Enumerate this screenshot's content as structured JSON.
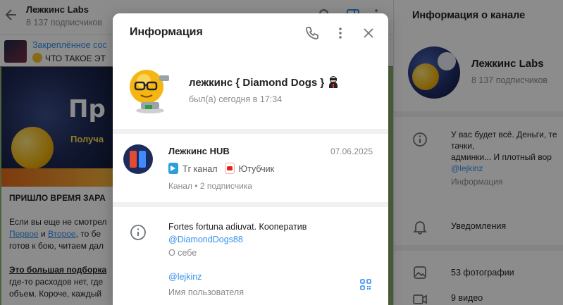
{
  "chat": {
    "title": "Лежкинс Labs",
    "subtitle": "8 137 подписчиков",
    "pinned_title": "Закреплённое сос",
    "pinned_text": "ЧТО ТАКОЕ ЭТ",
    "post_image_big": "Пр",
    "post_image_small": "Получа",
    "post_heading": "ПРИШЛО ВРЕМЯ ЗАРА",
    "post_line1": "Если вы еще не смотрел",
    "post_link1": "Первое",
    "post_and": " и ",
    "post_link2": "Второе",
    "post_line2_rest": ", то бе",
    "post_line3": "готов к бою, читаем дал",
    "post_heading2": "Это большая подборка",
    "post_line4": "где-то расходов нет, где",
    "post_line5": "объем. Короче, каждый"
  },
  "right_panel": {
    "title": "Информация о канале",
    "name": "Лежкинс Labs",
    "subscribers": "8 137 подписчиков",
    "desc_line1": "У вас будет всё. Деньги, те",
    "desc_line2": "тачки,",
    "desc_line3": "админки... И плотный вор",
    "desc_link": "@lejkinz",
    "desc_label": "Информация",
    "notifications": "Уведомления",
    "photos": "53 фотографии",
    "videos": "9 видео"
  },
  "modal": {
    "title": "Информация",
    "user_name": "лежкинс { Diamond Dogs }",
    "user_status": "был(а) сегодня в 17:34",
    "channel": {
      "name": "Лежкинс HUB",
      "date": "07.06.2025",
      "link1": "Тг канал",
      "link2": "Ютубчик",
      "meta": "Канал • 2 подписчика"
    },
    "about_text": "Fortes fortuna adiuvat. Кооператив",
    "about_link": "@DiamondDogs88",
    "about_label": "О себе",
    "username": "@lejkinz",
    "username_label": "Имя пользователя"
  }
}
